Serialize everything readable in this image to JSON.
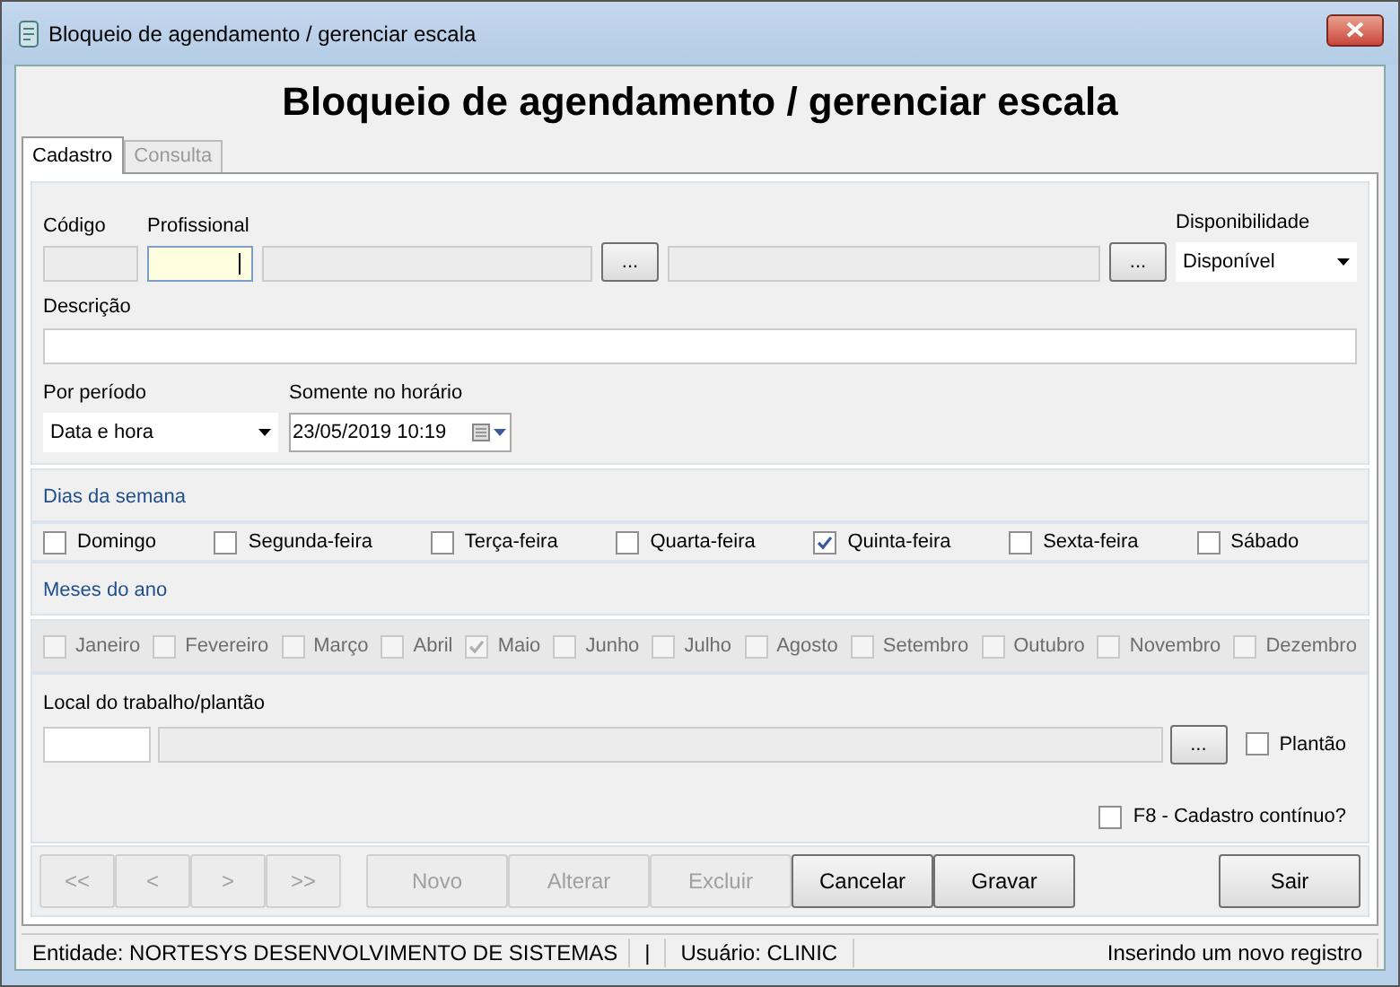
{
  "window": {
    "title": "Bloqueio de agendamento / gerenciar escala"
  },
  "heading": "Bloqueio de agendamento / gerenciar escala",
  "tabs": [
    {
      "label": "Cadastro",
      "selected": true
    },
    {
      "label": "Consulta",
      "selected": false
    }
  ],
  "fields": {
    "codigo_label": "Código",
    "profissional_label": "Profissional",
    "lookup_button": "...",
    "lookup_button_2": "...",
    "disponibilidade_label": "Disponibilidade",
    "disponibilidade_value": "Disponível",
    "descricao_label": "Descrição",
    "periodo_label": "Por período",
    "periodo_value": "Data e hora",
    "horario_label": "Somente no horário",
    "horario_value": "23/05/2019 10:19"
  },
  "dias_title": "Dias da semana",
  "dias": [
    {
      "label": "Domingo",
      "checked": false
    },
    {
      "label": "Segunda-feira",
      "checked": false
    },
    {
      "label": "Terça-feira",
      "checked": false
    },
    {
      "label": "Quarta-feira",
      "checked": false
    },
    {
      "label": "Quinta-feira",
      "checked": true
    },
    {
      "label": "Sexta-feira",
      "checked": false
    },
    {
      "label": "Sábado",
      "checked": false
    }
  ],
  "meses_title": "Meses do ano",
  "meses": [
    {
      "label": "Janeiro",
      "checked": false,
      "disabled": true
    },
    {
      "label": "Fevereiro",
      "checked": false,
      "disabled": true
    },
    {
      "label": "Março",
      "checked": false,
      "disabled": true
    },
    {
      "label": "Abril",
      "checked": false,
      "disabled": true
    },
    {
      "label": "Maio",
      "checked": true,
      "disabled": true
    },
    {
      "label": "Junho",
      "checked": false,
      "disabled": true
    },
    {
      "label": "Julho",
      "checked": false,
      "disabled": true
    },
    {
      "label": "Agosto",
      "checked": false,
      "disabled": true
    },
    {
      "label": "Setembro",
      "checked": false,
      "disabled": true
    },
    {
      "label": "Outubro",
      "checked": false,
      "disabled": true
    },
    {
      "label": "Novembro",
      "checked": false,
      "disabled": true
    },
    {
      "label": "Dezembro",
      "checked": false,
      "disabled": true
    }
  ],
  "local": {
    "label": "Local do trabalho/plantão",
    "lookup_button": "...",
    "plantao": {
      "label": "Plantão",
      "checked": false
    }
  },
  "continuo": {
    "label": "F8 - Cadastro contínuo?",
    "checked": false
  },
  "nav_buttons": [
    {
      "label": "<<",
      "disabled": true
    },
    {
      "label": "<",
      "disabled": true
    },
    {
      "label": ">",
      "disabled": true
    },
    {
      "label": ">>",
      "disabled": true
    }
  ],
  "action_buttons": [
    {
      "label": "Novo",
      "disabled": true
    },
    {
      "label": "Alterar",
      "disabled": true
    },
    {
      "label": "Excluir",
      "disabled": true
    },
    {
      "label": "Cancelar",
      "disabled": false
    },
    {
      "label": "Gravar",
      "disabled": false
    }
  ],
  "exit_button": {
    "label": "Sair",
    "disabled": false
  },
  "status_bar": {
    "entidade": "Entidade: NORTESYS DESENVOLVIMENTO DE SISTEMAS",
    "separator": "|",
    "usuario": "Usuário: CLINIC",
    "message": "Inserindo um novo registro"
  }
}
